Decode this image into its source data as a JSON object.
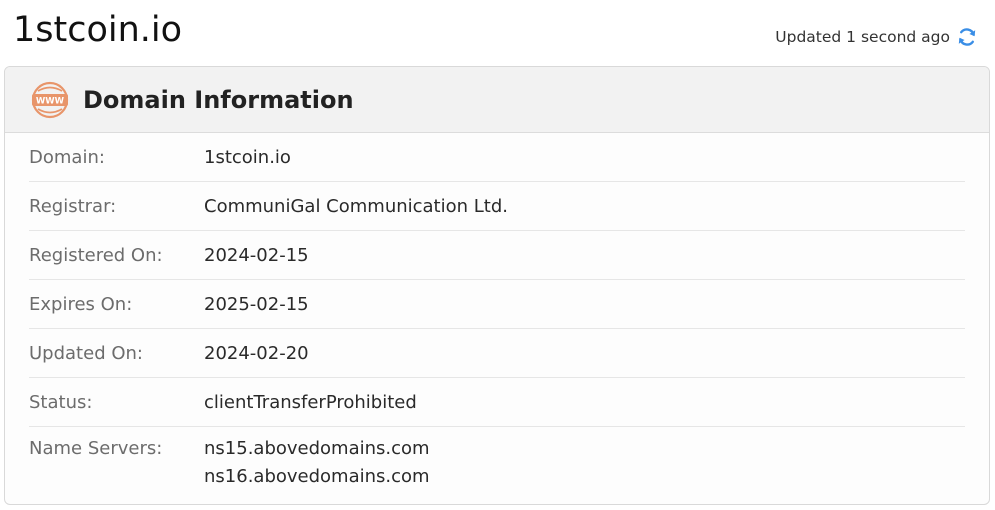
{
  "header": {
    "site_title": "1stcoin.io",
    "updated_text": "Updated 1 second ago"
  },
  "icons": {
    "refresh": "refresh-icon",
    "www": "www-icon"
  },
  "colors": {
    "accent_blue": "#3a8ee6",
    "www_orange": "#e8956a"
  },
  "card": {
    "title": "Domain Information",
    "www_text": "WWW",
    "rows": [
      {
        "label": "Domain:",
        "value": "1stcoin.io"
      },
      {
        "label": "Registrar:",
        "value": "CommuniGal Communication Ltd."
      },
      {
        "label": "Registered On:",
        "value": "2024-02-15"
      },
      {
        "label": "Expires On:",
        "value": "2025-02-15"
      },
      {
        "label": "Updated On:",
        "value": "2024-02-20"
      },
      {
        "label": "Status:",
        "value": "clientTransferProhibited"
      }
    ],
    "name_servers": {
      "label": "Name Servers:",
      "values": [
        "ns15.abovedomains.com",
        "ns16.abovedomains.com"
      ]
    }
  }
}
